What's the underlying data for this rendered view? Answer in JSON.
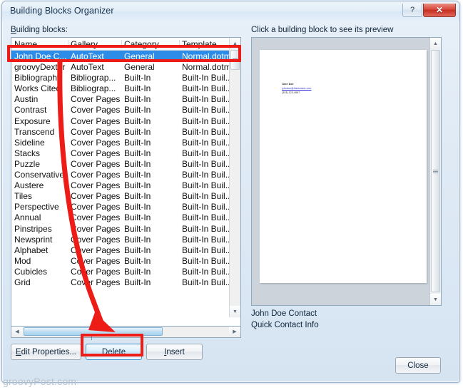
{
  "window": {
    "title": "Building Blocks Organizer",
    "help_label": "?",
    "close_label": "✕"
  },
  "list": {
    "label": "Building blocks:",
    "columns": [
      "Name",
      "Gallery",
      "Category",
      "Template"
    ],
    "rows": [
      {
        "name": "John Doe C...",
        "gallery": "AutoText",
        "category": "General",
        "template": "Normal.dotm",
        "selected": true
      },
      {
        "name": "groovyDexter",
        "gallery": "AutoText",
        "category": "General",
        "template": "Normal.dotm",
        "selected": false
      },
      {
        "name": "Bibliography",
        "gallery": "Bibliograp...",
        "category": "Built-In",
        "template": "Built-In Buil...",
        "selected": false
      },
      {
        "name": "Works Cited",
        "gallery": "Bibliograp...",
        "category": "Built-In",
        "template": "Built-In Buil...",
        "selected": false
      },
      {
        "name": "Austin",
        "gallery": "Cover Pages",
        "category": "Built-In",
        "template": "Built-In Buil...",
        "selected": false
      },
      {
        "name": "Contrast",
        "gallery": "Cover Pages",
        "category": "Built-In",
        "template": "Built-In Buil...",
        "selected": false
      },
      {
        "name": "Exposure",
        "gallery": "Cover Pages",
        "category": "Built-In",
        "template": "Built-In Buil...",
        "selected": false
      },
      {
        "name": "Transcend",
        "gallery": "Cover Pages",
        "category": "Built-In",
        "template": "Built-In Buil...",
        "selected": false
      },
      {
        "name": "Sideline",
        "gallery": "Cover Pages",
        "category": "Built-In",
        "template": "Built-In Buil...",
        "selected": false
      },
      {
        "name": "Stacks",
        "gallery": "Cover Pages",
        "category": "Built-In",
        "template": "Built-In Buil...",
        "selected": false
      },
      {
        "name": "Puzzle",
        "gallery": "Cover Pages",
        "category": "Built-In",
        "template": "Built-In Buil...",
        "selected": false
      },
      {
        "name": "Conservative",
        "gallery": "Cover Pages",
        "category": "Built-In",
        "template": "Built-In Buil...",
        "selected": false
      },
      {
        "name": "Austere",
        "gallery": "Cover Pages",
        "category": "Built-In",
        "template": "Built-In Buil...",
        "selected": false
      },
      {
        "name": "Tiles",
        "gallery": "Cover Pages",
        "category": "Built-In",
        "template": "Built-In Buil...",
        "selected": false
      },
      {
        "name": "Perspective",
        "gallery": "Cover Pages",
        "category": "Built-In",
        "template": "Built-In Buil...",
        "selected": false
      },
      {
        "name": "Annual",
        "gallery": "Cover Pages",
        "category": "Built-In",
        "template": "Built-In Buil...",
        "selected": false
      },
      {
        "name": "Pinstripes",
        "gallery": "Cover Pages",
        "category": "Built-In",
        "template": "Built-In Buil...",
        "selected": false
      },
      {
        "name": "Newsprint",
        "gallery": "Cover Pages",
        "category": "Built-In",
        "template": "Built-In Buil...",
        "selected": false
      },
      {
        "name": "Alphabet",
        "gallery": "Cover Pages",
        "category": "Built-In",
        "template": "Built-In Buil...",
        "selected": false
      },
      {
        "name": "Mod",
        "gallery": "Cover Pages",
        "category": "Built-In",
        "template": "Built-In Buil...",
        "selected": false
      },
      {
        "name": "Cubicles",
        "gallery": "Cover Pages",
        "category": "Built-In",
        "template": "Built-In Buil...",
        "selected": false
      },
      {
        "name": "Grid",
        "gallery": "Cover Pages",
        "category": "Built-In",
        "template": "Built-In Buil...",
        "selected": false
      }
    ]
  },
  "buttons": {
    "edit_properties": "Edit Properties...",
    "delete": "Delete",
    "insert": "Insert",
    "close": "Close"
  },
  "preview": {
    "label": "Click a building block to see its preview",
    "doc_name": "John Doe",
    "doc_email": "johndoe@hisdomain.com",
    "doc_phone": "(303) 123-4567",
    "caption_line1": "John Doe Contact",
    "caption_line2": "Quick Contact Info"
  },
  "watermark": "groovyPost.com",
  "colors": {
    "selection": "#2d8ce8",
    "annotation": "#ee1c16",
    "close_button": "#c62f22"
  }
}
